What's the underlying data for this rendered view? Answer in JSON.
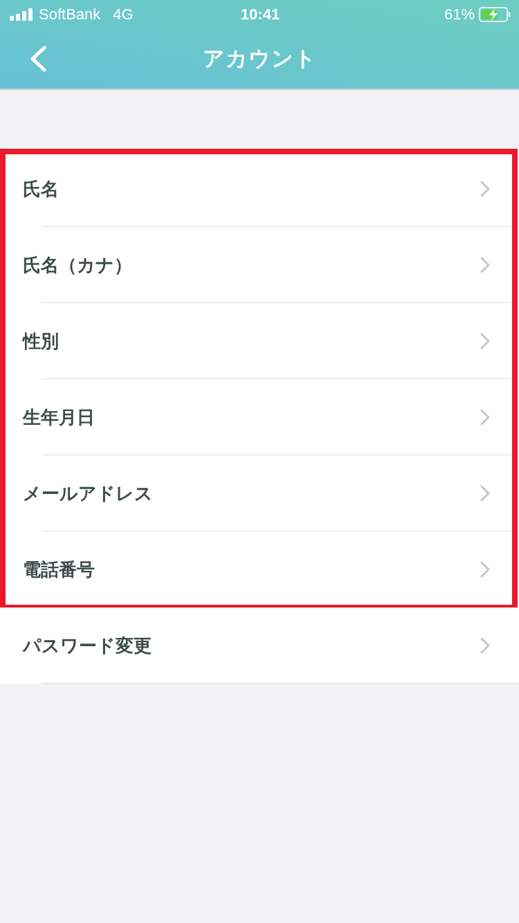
{
  "status_bar": {
    "carrier": "SoftBank",
    "network": "4G",
    "time": "10:41",
    "battery": "61%",
    "charging": true
  },
  "nav_bar": {
    "title": "アカウント"
  },
  "items": [
    {
      "label": "氏名",
      "highlighted": true
    },
    {
      "label": "氏名（カナ）",
      "highlighted": true
    },
    {
      "label": "性別",
      "highlighted": true
    },
    {
      "label": "生年月日",
      "highlighted": true
    },
    {
      "label": "メールアドレス",
      "highlighted": true
    },
    {
      "label": "電話番号",
      "highlighted": true
    },
    {
      "label": "パスワード変更",
      "highlighted": false
    }
  ]
}
